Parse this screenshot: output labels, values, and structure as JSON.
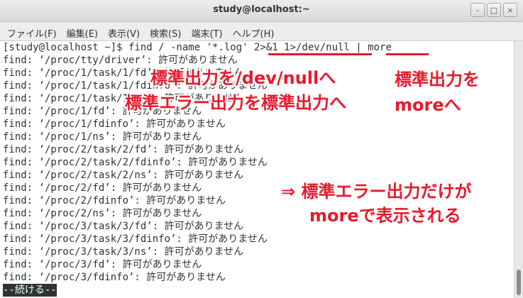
{
  "window": {
    "title": "study@localhost:~",
    "controls": [
      "–",
      "□",
      "×"
    ]
  },
  "menu": [
    "ファイル(F)",
    "編集(E)",
    "表示(V)",
    "検索(S)",
    "端末(T)",
    "ヘルプ(H)"
  ],
  "terminal": {
    "lines": [
      "[study@localhost ~]$ find / -name '*.log' 2>&1 1>/dev/null | more",
      "find: ‘/proc/tty/driver’: 許可がありません",
      "find: ‘/proc/1/task/1/fd’: 許可がありません",
      "find: ‘/proc/1/task/1/fdinfo’: 許可がありません",
      "find: ‘/proc/1/task/1/ns’: 許可がありません",
      "find: ‘/proc/1/fd’: 許可がありません",
      "find: ‘/proc/1/fdinfo’: 許可がありません",
      "find: ‘/proc/1/ns’: 許可がありません",
      "find: ‘/proc/2/task/2/fd’: 許可がありません",
      "find: ‘/proc/2/task/2/fdinfo’: 許可がありません",
      "find: ‘/proc/2/task/2/ns’: 許可がありません",
      "find: ‘/proc/2/fd’: 許可がありません",
      "find: ‘/proc/2/fdinfo’: 許可がありません",
      "find: ‘/proc/2/ns’: 許可がありません",
      "find: ‘/proc/3/task/3/fd’: 許可がありません",
      "find: ‘/proc/3/task/3/fdinfo’: 許可がありません",
      "find: ‘/proc/3/task/3/ns’: 許可がありません",
      "find: ‘/proc/3/fd’: 許可がありません",
      "find: ‘/proc/3/fdinfo’: 許可がありません"
    ],
    "pager_prompt": "--続ける--"
  },
  "annotations": {
    "redirect_stdout": "標準出力を/dev/nullへ",
    "redirect_stderr": "標準エラー出力を標準出力へ",
    "pipe_line1": "標準出力を",
    "pipe_line2": "moreへ",
    "result_line1": "⇒ 標準エラー出力だけが",
    "result_line2": "moreで表示される",
    "color": "#e8192c"
  }
}
